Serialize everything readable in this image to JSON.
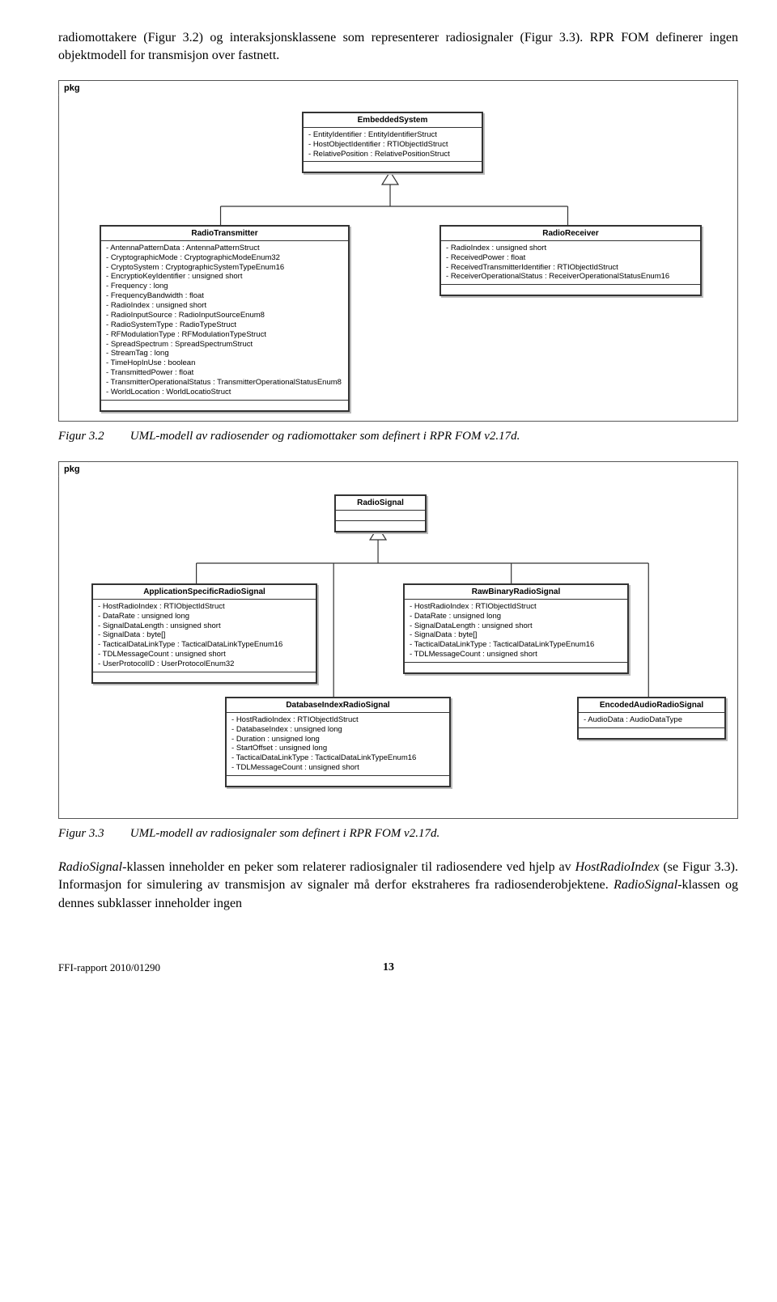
{
  "intro": "radiomottakere (Figur 3.2) og interaksjonsklassene som representerer radiosignaler (Figur 3.3). RPR FOM definerer ingen objektmodell for transmisjon over fastnett.",
  "diagram1": {
    "pkg": "pkg",
    "embedded": {
      "title": "EmbeddedSystem",
      "attrs": [
        "EntityIdentifier : EntityIdentifierStruct",
        "HostObjectIdentifier : RTIObjectIdStruct",
        "RelativePosition : RelativePositionStruct"
      ]
    },
    "transmitter": {
      "title": "RadioTransmitter",
      "attrs": [
        "AntennaPatternData : AntennaPatternStruct",
        "CryptographicMode : CryptographicModeEnum32",
        "CryptoSystem : CryptographicSystemTypeEnum16",
        "EncryptioKeyIdentifier : unsigned short",
        "Frequency : long",
        "FrequencyBandwidth : float",
        "RadioIndex : unsigned short",
        "RadioInputSource : RadioInputSourceEnum8",
        "RadioSystemType : RadioTypeStruct",
        "RFModulationType : RFModulationTypeStruct",
        "SpreadSpectrum : SpreadSpectrumStruct",
        "StreamTag : long",
        "TimeHopInUse : boolean",
        "TransmittedPower : float",
        "TransmitterOperationalStatus : TransmitterOperationalStatusEnum8",
        "WorldLocation : WorldLocatioStruct"
      ]
    },
    "receiver": {
      "title": "RadioReceiver",
      "attrs": [
        "RadioIndex : unsigned short",
        "ReceivedPower : float",
        "ReceivedTransmitterIdentifier : RTIObjectIdStruct",
        "ReceiverOperationalStatus : ReceiverOperationalStatusEnum16"
      ]
    }
  },
  "caption1": {
    "num": "Figur 3.2",
    "text": "UML-modell av radiosender og radiomottaker som definert i RPR FOM v2.17d."
  },
  "diagram2": {
    "pkg": "pkg",
    "root": {
      "title": "RadioSignal"
    },
    "app": {
      "title": "ApplicationSpecificRadioSignal",
      "attrs": [
        "HostRadioIndex : RTIObjectIdStruct",
        "DataRate : unsigned long",
        "SignalDataLength : unsigned short",
        "SignalData : byte[]",
        "TacticalDataLinkType : TacticalDataLinkTypeEnum16",
        "TDLMessageCount : unsigned short",
        "UserProtocolID : UserProtocolEnum32"
      ]
    },
    "raw": {
      "title": "RawBinaryRadioSignal",
      "attrs": [
        "HostRadioIndex : RTIObjectIdStruct",
        "DataRate : unsigned long",
        "SignalDataLength : unsigned short",
        "SignalData : byte[]",
        "TacticalDataLinkType : TacticalDataLinkTypeEnum16",
        "TDLMessageCount : unsigned short"
      ]
    },
    "db": {
      "title": "DatabaseIndexRadioSignal",
      "attrs": [
        "HostRadioIndex : RTIObjectIdStruct",
        "DatabaseIndex : unsigned long",
        "Duration : unsigned long",
        "StartOffset : unsigned long",
        "TacticalDataLinkType : TacticalDataLinkTypeEnum16",
        "TDLMessageCount : unsigned short"
      ]
    },
    "audio": {
      "title": "EncodedAudioRadioSignal",
      "attrs": [
        "AudioData : AudioDataType"
      ]
    }
  },
  "caption2": {
    "num": "Figur 3.3",
    "text": "UML-modell av radiosignaler som definert i RPR FOM v2.17d."
  },
  "para2": "RadioSignal-klassen inneholder en peker som relaterer radiosignaler til radiosendere ved hjelp av HostRadioIndex (se Figur 3.3). Informasjon for simulering av transmisjon av signaler må derfor ekstraheres fra radiosenderobjektene. RadioSignal-klassen og dennes subklasser inneholder ingen",
  "footer": {
    "report": "FFI-rapport 2010/01290",
    "page": "13"
  }
}
